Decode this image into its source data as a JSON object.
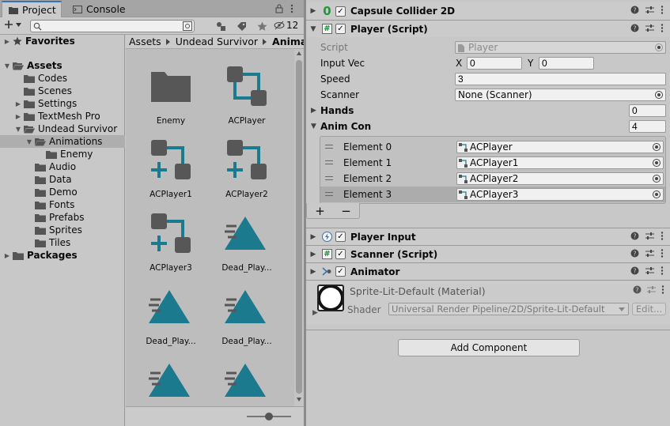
{
  "project_window": {
    "tabs": [
      {
        "label": "Project",
        "icon": "folder-icon",
        "active": true
      },
      {
        "label": "Console",
        "icon": "console-icon",
        "active": false
      }
    ],
    "search_placeholder": "",
    "hidden_packages_count": "12",
    "tree": [
      {
        "label": "Favorites",
        "bold": true,
        "depth": 0,
        "arrow": "collapsed",
        "icon": "star-icon"
      },
      {
        "label": "Assets",
        "bold": true,
        "depth": 0,
        "arrow": "expanded",
        "icon": "folder-open-icon"
      },
      {
        "label": "Codes",
        "depth": 1,
        "arrow": "none",
        "icon": "folder-icon"
      },
      {
        "label": "Scenes",
        "depth": 1,
        "arrow": "none",
        "icon": "folder-icon"
      },
      {
        "label": "Settings",
        "depth": 1,
        "arrow": "collapsed",
        "icon": "folder-icon"
      },
      {
        "label": "TextMesh Pro",
        "depth": 1,
        "arrow": "collapsed",
        "icon": "folder-icon"
      },
      {
        "label": "Undead Survivor",
        "depth": 1,
        "arrow": "expanded",
        "icon": "folder-open-icon"
      },
      {
        "label": "Animations",
        "depth": 2,
        "arrow": "expanded",
        "icon": "folder-open-icon",
        "selected": true
      },
      {
        "label": "Enemy",
        "depth": 3,
        "arrow": "none",
        "icon": "folder-icon"
      },
      {
        "label": "Audio",
        "depth": 2,
        "arrow": "none",
        "icon": "folder-icon"
      },
      {
        "label": "Data",
        "depth": 2,
        "arrow": "none",
        "icon": "folder-icon"
      },
      {
        "label": "Demo",
        "depth": 2,
        "arrow": "none",
        "icon": "folder-icon"
      },
      {
        "label": "Fonts",
        "depth": 2,
        "arrow": "none",
        "icon": "folder-icon"
      },
      {
        "label": "Prefabs",
        "depth": 2,
        "arrow": "none",
        "icon": "folder-icon"
      },
      {
        "label": "Sprites",
        "depth": 2,
        "arrow": "none",
        "icon": "folder-icon"
      },
      {
        "label": "Tiles",
        "depth": 2,
        "arrow": "none",
        "icon": "folder-icon"
      },
      {
        "label": "Packages",
        "bold": true,
        "depth": 0,
        "arrow": "collapsed",
        "icon": "folder-icon"
      }
    ],
    "breadcrumb": [
      "Assets",
      "Undead Survivor",
      "Animations"
    ],
    "assets": [
      {
        "label": "Enemy",
        "type": "folder"
      },
      {
        "label": "ACPlayer",
        "type": "controller"
      },
      {
        "label": "ACPlayer1",
        "type": "override"
      },
      {
        "label": "ACPlayer2",
        "type": "override"
      },
      {
        "label": "ACPlayer3",
        "type": "override"
      },
      {
        "label": "Dead_Play...",
        "type": "clip"
      },
      {
        "label": "Dead_Play...",
        "type": "clip"
      },
      {
        "label": "Dead_Play...",
        "type": "clip"
      },
      {
        "label": "",
        "type": "clip"
      },
      {
        "label": "",
        "type": "clip"
      }
    ],
    "zoom_level": 0.5
  },
  "inspector": {
    "capsule_collider": {
      "title": "Capsule Collider 2D",
      "icon_glyph": "0",
      "enabled": true
    },
    "player_script": {
      "title": "Player (Script)",
      "icon_glyph": "#",
      "enabled": true,
      "script_label": "Script",
      "script_value": "Player",
      "input_vec_label": "Input Vec",
      "x_label": "X",
      "x_value": "0",
      "y_label": "Y",
      "y_value": "0",
      "speed_label": "Speed",
      "speed_value": "3",
      "scanner_label": "Scanner",
      "scanner_value": "None (Scanner)",
      "hands_label": "Hands",
      "hands_value": "0",
      "anim_con_label": "Anim Con",
      "anim_con_size": "4",
      "elements": [
        {
          "label": "Element 0",
          "value": "ACPlayer"
        },
        {
          "label": "Element 1",
          "value": "ACPlayer1"
        },
        {
          "label": "Element 2",
          "value": "ACPlayer2"
        },
        {
          "label": "Element 3",
          "value": "ACPlayer3",
          "selected": true
        }
      ],
      "add_glyph": "+",
      "remove_glyph": "−"
    },
    "player_input": {
      "title": "Player Input",
      "icon_glyph": "⚡",
      "enabled": true
    },
    "scanner_script": {
      "title": "Scanner (Script)",
      "icon_glyph": "#",
      "enabled": true
    },
    "animator": {
      "title": "Animator",
      "enabled": true
    },
    "material": {
      "name": "Sprite-Lit-Default (Material)",
      "shader_label": "Shader",
      "shader_value": "Universal Render Pipeline/2D/Sprite-Lit-Default",
      "edit_label": "Edit..."
    },
    "add_component_label": "Add Component"
  },
  "colors": {
    "accent_teal": "#1b7a8e",
    "icon_gray": "#575757",
    "selection": "#aeaeae",
    "tab_active_border": "#3a72b0"
  }
}
